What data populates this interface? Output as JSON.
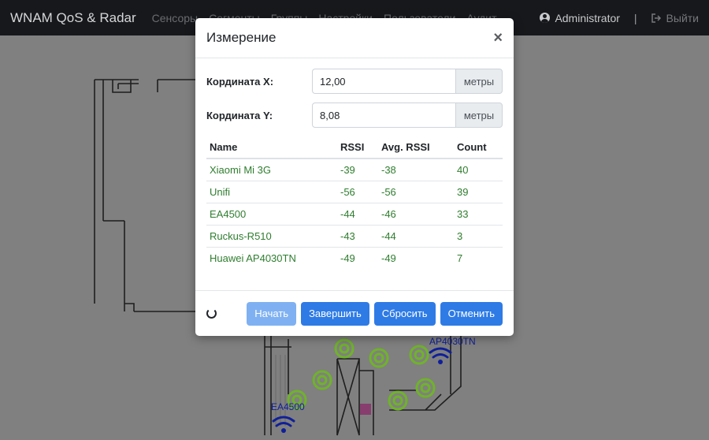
{
  "navbar": {
    "brand": "WNAM QoS & Radar",
    "items": [
      "Сенсоры",
      "Сегменты",
      "Группы",
      "Настройки",
      "Пользователи",
      "Аудит"
    ],
    "user": "Administrator",
    "separator": "|",
    "logout": "Выйти"
  },
  "floorplan": {
    "labels": [
      "EA4500",
      "AP4030TN"
    ]
  },
  "modal": {
    "title": "Измерение",
    "close": "×",
    "x": {
      "label": "Кордината X:",
      "value": "12,00",
      "unit": "метры"
    },
    "y": {
      "label": "Кордината Y:",
      "value": "8,08",
      "unit": "метры"
    },
    "table": {
      "headers": [
        "Name",
        "RSSI",
        "Avg. RSSI",
        "Count"
      ],
      "rows": [
        [
          "Xiaomi Mi 3G",
          "-39",
          "-38",
          "40"
        ],
        [
          "Unifi",
          "-56",
          "-56",
          "39"
        ],
        [
          "EA4500",
          "-44",
          "-46",
          "33"
        ],
        [
          "Ruckus-R510",
          "-43",
          "-44",
          "3"
        ],
        [
          "Huawei AP4030TN",
          "-49",
          "-49",
          "7"
        ]
      ]
    },
    "buttons": {
      "start": "Начать",
      "finish": "Завершить",
      "reset": "Сбросить",
      "cancel": "Отменить"
    }
  },
  "colors": {
    "primary": "#2e7be6",
    "primary_disabled": "#7fb1f2",
    "table_text": "#2f7d2f",
    "wifi_blue": "#0f1f9a",
    "sensor_green": "#6fb32a"
  }
}
